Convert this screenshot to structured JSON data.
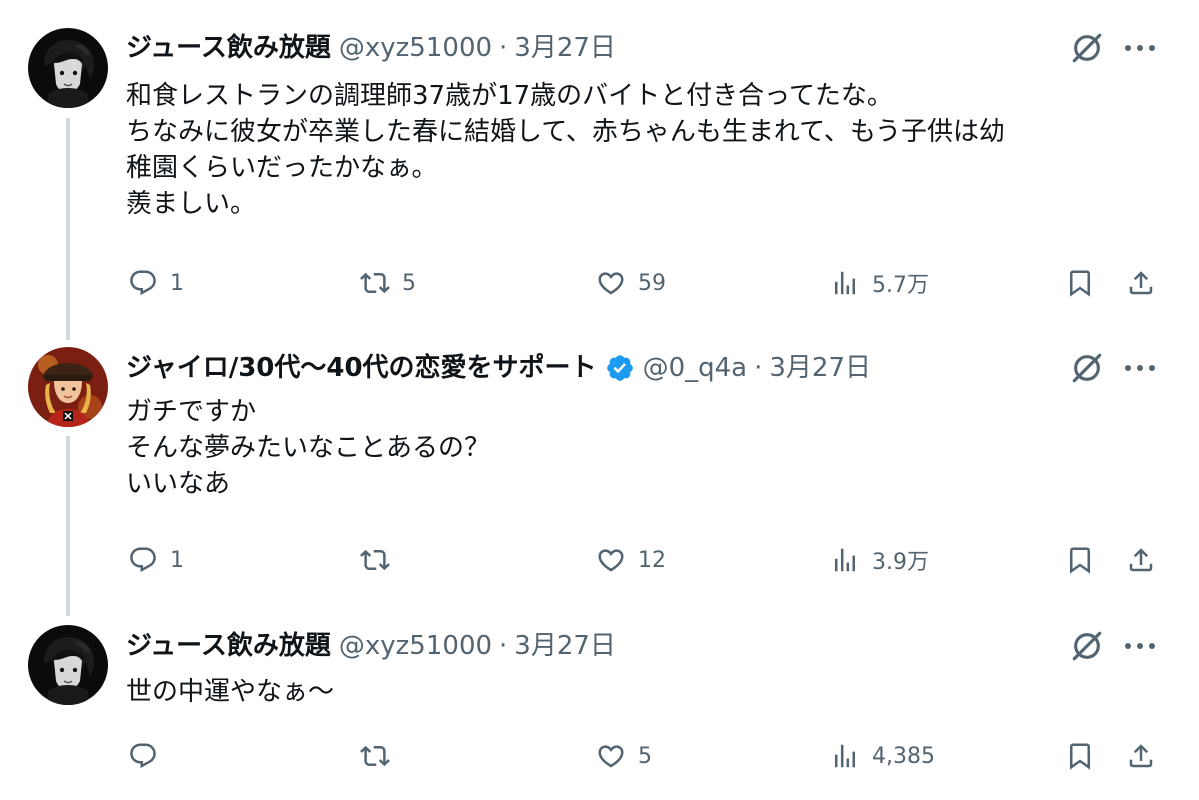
{
  "tweets": [
    {
      "name": "ジュース飲み放題",
      "handle": "@xyz51000",
      "separator": "·",
      "date": "3月27日",
      "verified": false,
      "lines": [
        "和食レストランの調理師37歳が17歳のバイトと付き合ってたな。",
        "ちなみに彼女が卒業した春に結婚して、赤ちゃんも生まれて、もう子供は幼",
        "稚園くらいだったかなぁ。",
        "羨ましい。"
      ],
      "replies": "1",
      "retweets": "5",
      "likes": "59",
      "views": "5.7万"
    },
    {
      "name": "ジャイロ/30代〜40代の恋愛をサポート",
      "handle": "@0_q4a",
      "separator": "·",
      "date": "3月27日",
      "verified": true,
      "lines": [
        "ガチですか",
        "そんな夢みたいなことあるの？",
        "いいなあ"
      ],
      "replies": "1",
      "retweets": "",
      "likes": "12",
      "views": "3.9万"
    },
    {
      "name": "ジュース飲み放題",
      "handle": "@xyz51000",
      "separator": "·",
      "date": "3月27日",
      "verified": false,
      "lines": [
        "世の中運やなぁ〜"
      ],
      "replies": "",
      "retweets": "",
      "likes": "5",
      "views": "4,385"
    }
  ],
  "colors": {
    "text": "#0f1419",
    "secondary": "#536471",
    "thread_line": "#cfd9de",
    "verified": "#1d9bf0"
  },
  "icons": [
    "grok-icon",
    "more-icon",
    "reply-icon",
    "retweet-icon",
    "like-icon",
    "views-icon",
    "bookmark-icon",
    "share-icon",
    "verified-badge-icon"
  ]
}
